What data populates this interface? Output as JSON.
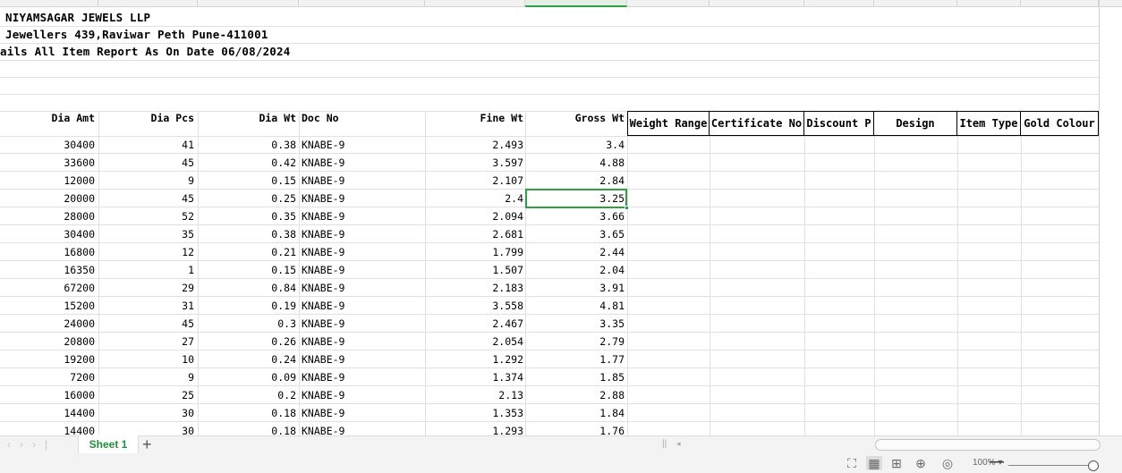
{
  "sheet": {
    "title_lines": [
      "NIYAMSAGAR JEWELS LLP",
      "Jewellers 439,Raviwar Peth Pune-411001",
      "ails All Item Report As On Date 06/08/2024"
    ],
    "headers": {
      "dia_amt": "Dia Amt",
      "dia_pcs": "Dia Pcs",
      "dia_wt": "Dia Wt",
      "doc_no": "Doc No",
      "fine_wt": "Fine Wt",
      "gross_wt": "Gross Wt",
      "weight_range": "Weight Range",
      "certificate_no": "Certificate No",
      "discount_p": "Discount P",
      "design": "Design",
      "item_type": "Item Type",
      "gold_colour": "Gold Colour"
    },
    "rows": [
      [
        "30400",
        "41",
        "0.38",
        "KNABE-9",
        "2.493",
        "3.4"
      ],
      [
        "33600",
        "45",
        "0.42",
        "KNABE-9",
        "3.597",
        "4.88"
      ],
      [
        "12000",
        "9",
        "0.15",
        "KNABE-9",
        "2.107",
        "2.84"
      ],
      [
        "20000",
        "45",
        "0.25",
        "KNABE-9",
        "2.4",
        "3.25"
      ],
      [
        "28000",
        "52",
        "0.35",
        "KNABE-9",
        "2.094",
        "3.66"
      ],
      [
        "30400",
        "35",
        "0.38",
        "KNABE-9",
        "2.681",
        "3.65"
      ],
      [
        "16800",
        "12",
        "0.21",
        "KNABE-9",
        "1.799",
        "2.44"
      ],
      [
        "16350",
        "1",
        "0.15",
        "KNABE-9",
        "1.507",
        "2.04"
      ],
      [
        "67200",
        "29",
        "0.84",
        "KNABE-9",
        "2.183",
        "3.91"
      ],
      [
        "15200",
        "31",
        "0.19",
        "KNABE-9",
        "3.558",
        "4.81"
      ],
      [
        "24000",
        "45",
        "0.3",
        "KNABE-9",
        "2.467",
        "3.35"
      ],
      [
        "20800",
        "27",
        "0.26",
        "KNABE-9",
        "2.054",
        "2.79"
      ],
      [
        "19200",
        "10",
        "0.24",
        "KNABE-9",
        "1.292",
        "1.77"
      ],
      [
        "7200",
        "9",
        "0.09",
        "KNABE-9",
        "1.374",
        "1.85"
      ],
      [
        "16000",
        "25",
        "0.2",
        "KNABE-9",
        "2.13",
        "2.88"
      ],
      [
        "14400",
        "30",
        "0.18",
        "KNABE-9",
        "1.353",
        "1.84"
      ],
      [
        "14400",
        "30",
        "0.18",
        "KNABE-9",
        "1.293",
        "1.76"
      ]
    ],
    "selected_cell_value": "3.25"
  },
  "tabs": {
    "active_sheet": "Sheet 1",
    "add_sheet": "+"
  },
  "status": {
    "zoom": "100% ▾"
  },
  "colors": {
    "accent_green": "#2ea043",
    "grid": "#e1e1e1"
  },
  "icons": [
    "fullscreen-icon",
    "normal-view-icon",
    "page-break-view-icon",
    "page-layout-icon",
    "reading-mode-icon",
    "zoom-out-icon"
  ]
}
